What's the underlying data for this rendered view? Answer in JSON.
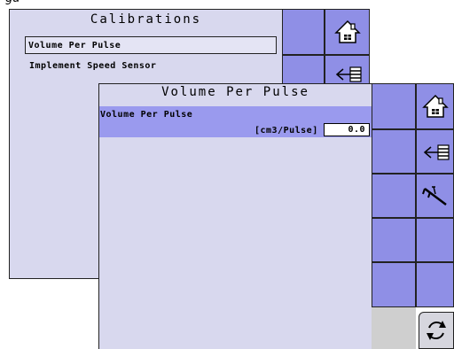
{
  "caption_fragment": "gu",
  "back_screen": {
    "title": "Calibrations",
    "items": [
      {
        "label": "Volume Per Pulse",
        "selected": true
      },
      {
        "label": "Implement Speed Sensor",
        "selected": false
      }
    ]
  },
  "front_screen": {
    "title": "Volume Per Pulse",
    "field_label": "Volume Per Pulse",
    "unit": "[cm3/Pulse]",
    "value": "0.0"
  },
  "icons": {
    "home": "home-icon",
    "back": "back-list-icon",
    "tools": "caliper-icon",
    "refresh": "refresh-icon"
  },
  "colors": {
    "panel": "#d8d8ee",
    "button": "#8f8fe6",
    "highlight": "#9a9aee"
  }
}
